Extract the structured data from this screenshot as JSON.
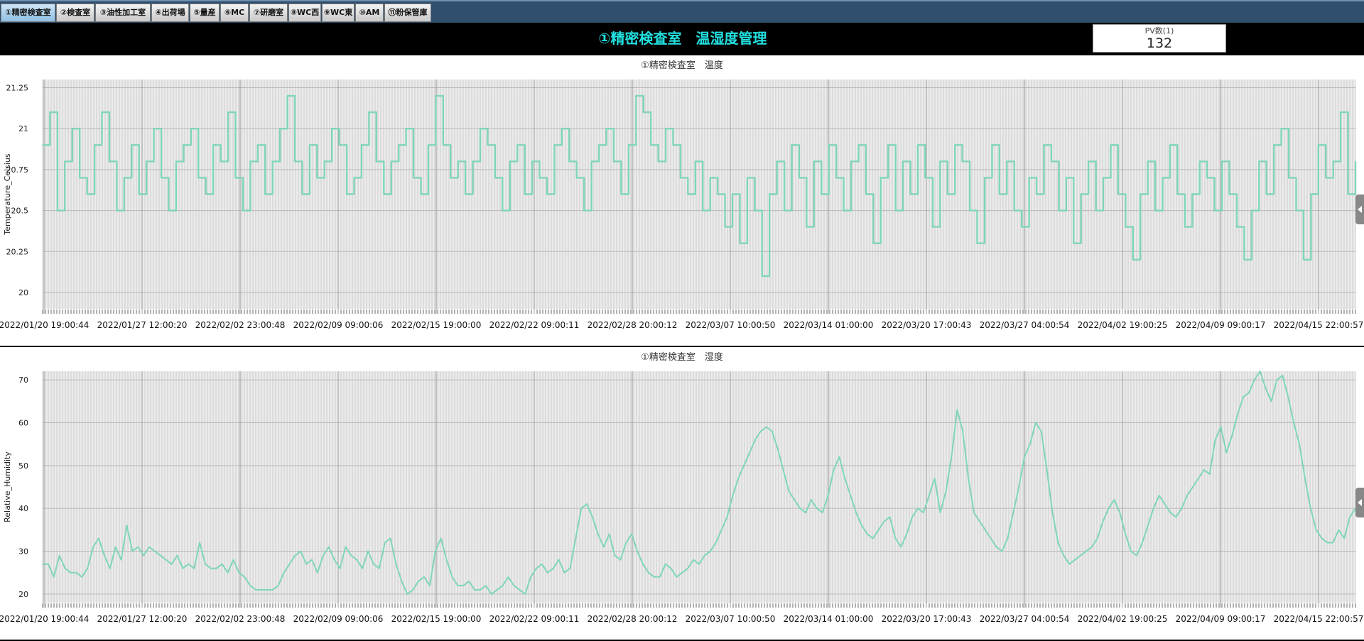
{
  "tabs": [
    {
      "label": "①精密検査室",
      "active": true
    },
    {
      "label": "②検査室"
    },
    {
      "label": "③油性加工室"
    },
    {
      "label": "④出荷場"
    },
    {
      "label": "⑤量産"
    },
    {
      "label": "⑥MC"
    },
    {
      "label": "⑦研磨室"
    },
    {
      "label": "⑧WC西"
    },
    {
      "label": "⑨WC東"
    },
    {
      "label": "⑩AM"
    },
    {
      "label": "⑪粉保管庫"
    }
  ],
  "header": {
    "title": "①精密検査室　温湿度管理",
    "pv_label": "PV数(1)",
    "pv_value": "132"
  },
  "colors": {
    "series": "#7fd6b6",
    "title": "#22e0e0",
    "plot_bg": "#ebebeb"
  },
  "chart_data": [
    {
      "type": "line",
      "title": "①精密検査室　温度",
      "ylabel": "Temperature_Celsius",
      "xlabel": "",
      "ylim": [
        19.9,
        21.3
      ],
      "yticks": [
        20,
        20.25,
        20.5,
        20.75,
        21,
        21.25
      ],
      "xticks": [
        "2022/01/20 19:00:44",
        "2022/01/27 12:00:20",
        "2022/02/02 23:00:48",
        "2022/02/09 09:00:06",
        "2022/02/15 19:00:00",
        "2022/02/22 09:00:11",
        "2022/02/28 20:00:12",
        "2022/03/07 10:00:50",
        "2022/03/14 01:00:00",
        "2022/03/20 17:00:43",
        "2022/03/27 04:00:54",
        "2022/04/02 19:00:25",
        "2022/04/09 09:00:17",
        "2022/04/15 22:00:57"
      ],
      "grid": true,
      "series": [
        {
          "values": [
            20.9,
            21.1,
            20.5,
            20.8,
            21.0,
            20.7,
            20.6,
            20.9,
            21.1,
            20.8,
            20.5,
            20.7,
            20.9,
            20.6,
            20.8,
            21.0,
            20.7,
            20.5,
            20.8,
            20.9,
            21.0,
            20.7,
            20.6,
            20.9,
            20.8,
            21.1,
            20.7,
            20.5,
            20.8,
            20.9,
            20.6,
            20.8,
            21.0,
            21.2,
            20.8,
            20.6,
            20.9,
            20.7,
            20.8,
            21.0,
            20.9,
            20.6,
            20.7,
            20.9,
            21.1,
            20.8,
            20.6,
            20.8,
            20.9,
            21.0,
            20.7,
            20.6,
            20.9,
            21.2,
            20.9,
            20.7,
            20.8,
            20.6,
            20.8,
            21.0,
            20.9,
            20.7,
            20.5,
            20.8,
            20.9,
            20.6,
            20.8,
            20.7,
            20.6,
            20.9,
            21.0,
            20.8,
            20.7,
            20.5,
            20.8,
            20.9,
            21.0,
            20.8,
            20.6,
            20.9,
            21.2,
            21.1,
            20.9,
            20.8,
            21.0,
            20.9,
            20.7,
            20.6,
            20.8,
            20.5,
            20.7,
            20.6,
            20.4,
            20.6,
            20.3,
            20.7,
            20.5,
            20.1,
            20.6,
            20.8,
            20.5,
            20.9,
            20.7,
            20.4,
            20.8,
            20.6,
            20.9,
            20.7,
            20.5,
            20.8,
            20.9,
            20.6,
            20.3,
            20.7,
            20.9,
            20.5,
            20.8,
            20.6,
            20.9,
            20.7,
            20.4,
            20.8,
            20.6,
            20.9,
            20.8,
            20.5,
            20.3,
            20.7,
            20.9,
            20.6,
            20.8,
            20.5,
            20.4,
            20.7,
            20.6,
            20.9,
            20.8,
            20.5,
            20.7,
            20.3,
            20.6,
            20.8,
            20.5,
            20.7,
            20.9,
            20.6,
            20.4,
            20.2,
            20.6,
            20.8,
            20.5,
            20.7,
            20.9,
            20.6,
            20.4,
            20.6,
            20.8,
            20.7,
            20.5,
            20.8,
            20.6,
            20.4,
            20.2,
            20.5,
            20.8,
            20.6,
            20.9,
            21.0,
            20.7,
            20.5,
            20.2,
            20.6,
            20.9,
            20.7,
            20.8,
            21.1,
            20.6,
            20.8
          ]
        }
      ]
    },
    {
      "type": "line",
      "title": "①精密検査室　湿度",
      "ylabel": "Relative_Humidity",
      "xlabel": "",
      "ylim": [
        18,
        72
      ],
      "yticks": [
        20,
        30,
        40,
        50,
        60,
        70
      ],
      "xticks": [
        "2022/01/20 19:00:44",
        "2022/01/27 12:00:20",
        "2022/02/02 23:00:48",
        "2022/02/09 09:00:06",
        "2022/02/15 19:00:00",
        "2022/02/22 09:00:11",
        "2022/02/28 20:00:12",
        "2022/03/07 10:00:50",
        "2022/03/14 01:00:00",
        "2022/03/20 17:00:43",
        "2022/03/27 04:00:54",
        "2022/04/02 19:00:25",
        "2022/04/09 09:00:17",
        "2022/04/15 22:00:57"
      ],
      "grid": true,
      "series": [
        {
          "values": [
            27,
            27,
            24,
            29,
            26,
            25,
            25,
            24,
            26,
            31,
            33,
            29,
            26,
            31,
            28,
            36,
            30,
            31,
            29,
            31,
            30,
            29,
            28,
            27,
            29,
            26,
            27,
            26,
            32,
            27,
            26,
            26,
            27,
            25,
            28,
            25,
            24,
            22,
            21,
            21,
            21,
            21,
            22,
            25,
            27,
            29,
            30,
            27,
            28,
            25,
            29,
            31,
            28,
            26,
            31,
            29,
            28,
            26,
            30,
            27,
            26,
            32,
            33,
            27,
            23,
            20,
            21,
            23,
            24,
            22,
            30,
            33,
            28,
            24,
            22,
            22,
            23,
            21,
            21,
            22,
            20,
            21,
            22,
            24,
            22,
            21,
            20,
            24,
            26,
            27,
            25,
            26,
            28,
            25,
            26,
            33,
            40,
            41,
            38,
            34,
            31,
            34,
            29,
            28,
            32,
            34,
            30,
            27,
            25,
            24,
            24,
            27,
            26,
            24,
            25,
            26,
            28,
            27,
            29,
            30,
            32,
            35,
            38,
            43,
            47,
            50,
            53,
            56,
            58,
            59,
            58,
            54,
            49,
            44,
            42,
            40,
            39,
            42,
            40,
            39,
            43,
            49,
            52,
            47,
            43,
            39,
            36,
            34,
            33,
            35,
            37,
            38,
            33,
            31,
            34,
            38,
            40,
            39,
            43,
            47,
            39,
            44,
            52,
            63,
            58,
            47,
            39,
            37,
            35,
            33,
            31,
            30,
            33,
            39,
            45,
            52,
            55,
            60,
            58,
            49,
            39,
            32,
            29,
            27,
            28,
            29,
            30,
            31,
            33,
            37,
            40,
            42,
            39,
            34,
            30,
            29,
            32,
            36,
            40,
            43,
            41,
            39,
            38,
            40,
            43,
            45,
            47,
            49,
            48,
            56,
            59,
            53,
            57,
            62,
            66,
            67,
            70,
            72,
            68,
            65,
            70,
            71,
            66,
            60,
            55,
            47,
            40,
            35,
            33,
            32,
            32,
            35,
            33,
            38,
            40
          ]
        }
      ]
    }
  ]
}
